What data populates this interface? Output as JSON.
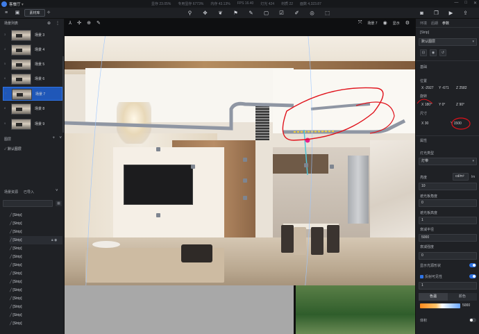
{
  "app": {
    "title": "客餐厅",
    "stats": [
      "显存 23.05%",
      "专用显存 6773%",
      "内存 43.13%",
      "FPS 16.40",
      "灯光 424",
      "材质 22",
      "面数 4,323.87"
    ],
    "window_controls": [
      "—",
      "□",
      "✕"
    ]
  },
  "toolbar": {
    "menu_icon": "≡",
    "material_btn": "素材库",
    "center_icons": [
      "bulb-icon",
      "move-icon",
      "leaf-icon",
      "flag-icon",
      "pen-icon",
      "square-icon",
      "check-icon",
      "brush-icon",
      "circle-icon",
      "box-icon"
    ],
    "right_icons": [
      "camera-icon",
      "layers-icon",
      "video-icon",
      "export-icon"
    ]
  },
  "left": {
    "scene_list_title": "场景列表",
    "scenes": [
      {
        "name": "场景 3",
        "num": "3"
      },
      {
        "name": "场景 4",
        "num": "4"
      },
      {
        "name": "场景 5",
        "num": "5"
      },
      {
        "name": "场景 6",
        "num": "6"
      },
      {
        "name": "场景 7",
        "num": "7"
      },
      {
        "name": "场景 8",
        "num": "8"
      },
      {
        "name": "场景 9",
        "num": "9"
      }
    ],
    "layers_title": "图层",
    "layer_default": "默认图层",
    "resources_tab": "场景资源",
    "imported_tab": "已导入",
    "strips": [
      "[Strip]",
      "[Strip]",
      "[Strip]",
      "[Strip]",
      "[Strip]",
      "[Strip]",
      "[Strip]",
      "[Strip]",
      "[Strip]",
      "[Strip]",
      "[Strip]",
      "[Strip]",
      "[Strip]",
      "[Strip]"
    ]
  },
  "viewport": {
    "scene_selector": "场景 7",
    "display_label": "显示"
  },
  "right": {
    "tabs": [
      "环境",
      "后期",
      "参数"
    ],
    "strip_title": "[Strip]",
    "layer_select": "默认图层",
    "basic_title": "基础",
    "position_label": "位置",
    "position": {
      "x": "X -2927",
      "y": "Y -671",
      "z": "Z 2582"
    },
    "rotation_label": "旋转",
    "rotation": {
      "x": "X 180°",
      "y": "Y 0°",
      "z": "Z 90°"
    },
    "size_label": "尺寸",
    "size": {
      "x": "X 30",
      "y": "Y 1500"
    },
    "attr_title": "属性",
    "light_type_label": "灯光类型",
    "light_type": "灯带",
    "brightness_label": "亮度",
    "brightness_unit": "cd/m²",
    "brightness_unit2": "lm",
    "brightness_value": "10",
    "beam_angle_label": "遮光板角度",
    "beam_angle_value": "0",
    "beam_height_label": "遮光板高度",
    "beam_height_value": "1",
    "falloff_radius_label": "衰减半径",
    "falloff_radius_value": "5000",
    "falloff_strength_label": "衰减强度",
    "falloff_strength_value": "0",
    "show_shape_label": "显示光源形状",
    "reflect_label": "反射可见性",
    "reflect_value": "1",
    "color_tabs": [
      "色温",
      "颜色"
    ],
    "color_temp_value": "5000",
    "volume_label": "体积"
  },
  "colors": {
    "accent": "#2f74e6",
    "annotation": "#e0121b",
    "strip_light": "#8f96a3"
  }
}
